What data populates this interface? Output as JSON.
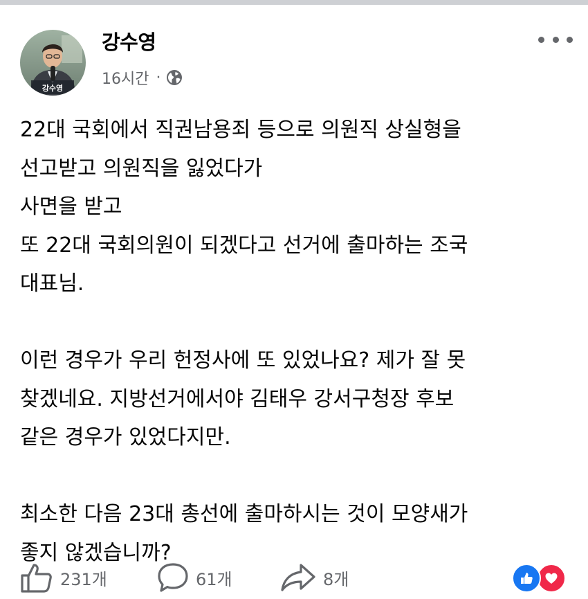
{
  "post": {
    "author": "강수영",
    "avatar_caption": "강수영",
    "time": "16시간",
    "separator": "·",
    "privacy_icon": "globe-icon",
    "more_icon": "more-options-icon",
    "body_lines": [
      "22대 국회에서 직권남용죄 등으로 의원직 상실형을",
      "선고받고 의원직을 잃었다가",
      "사면을 받고",
      "또 22대 국회의원이 되겠다고 선거에 출마하는 조국",
      "대표님.",
      "",
      "이런 경우가 우리 헌정사에 또 있었나요? 제가 잘 못",
      "찾겠네요. 지방선거에서야 김태우 강서구청장 후보",
      "같은 경우가 있었다지만.",
      "",
      "최소한 다음 23대 총선에 출마하시는 것이 모양새가",
      "좋지 않겠습니까?"
    ]
  },
  "actions": {
    "like_count": "231개",
    "comment_count": "61개",
    "share_count": "8개"
  },
  "reactions": {
    "like_icon": "like-reaction-icon",
    "love_icon": "love-reaction-icon",
    "like_color": "#1877f2",
    "love_color": "#f02849"
  },
  "colors": {
    "text": "#050505",
    "secondary": "#65676b",
    "divider": "#ced0d4"
  }
}
